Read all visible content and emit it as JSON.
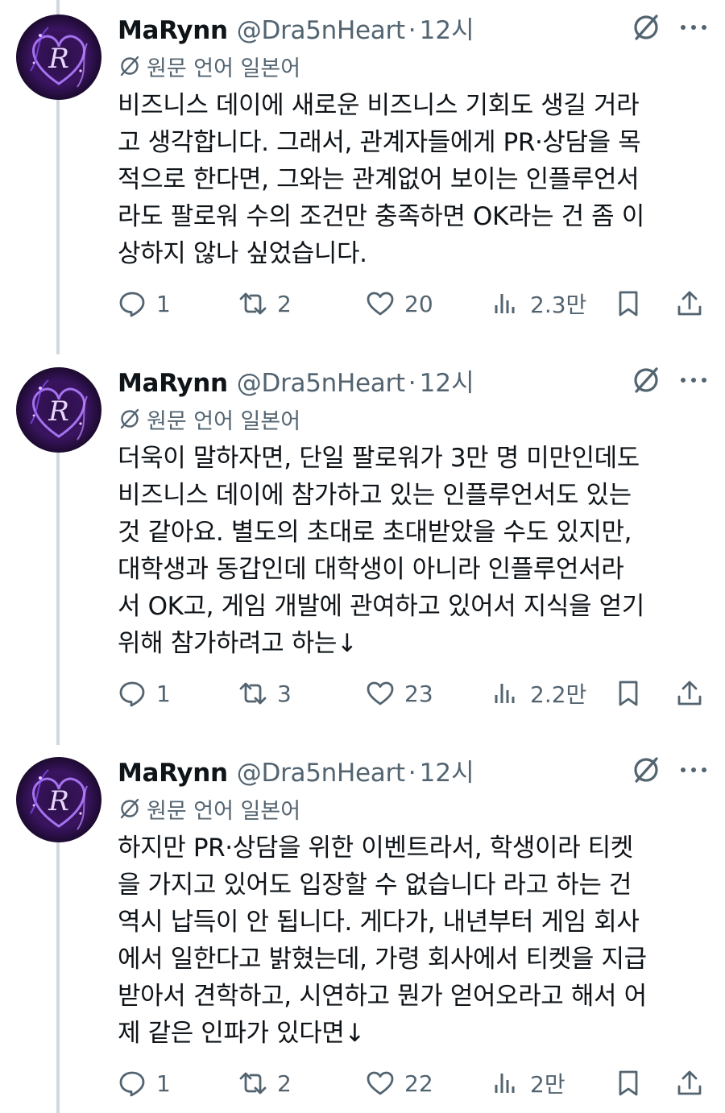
{
  "author": {
    "name": "MaRynn",
    "handle": "@Dra5nHeart",
    "separator": "·",
    "avatar_initial": "R"
  },
  "colors": {
    "text": "#0f1419",
    "secondary": "#536471",
    "thread_line": "#cfd9de",
    "avatar_glow": "#a46bff"
  },
  "tweets": [
    {
      "time": "12시",
      "language_note": "원문 언어 일본어",
      "text": "비즈니스 데이에 새로운 비즈니스 기회도 생길 거라\n고 생각합니다. 그래서, 관계자들에게 PR·상담을 목\n적으로 한다면, 그와는 관계없어 보이는 인플루언서\n라도 팔로워 수의 조건만 충족하면 OK라는 건 좀 이\n상하지 않나 싶었습니다.",
      "replies": "1",
      "retweets": "2",
      "likes": "20",
      "views": "2.3만"
    },
    {
      "time": "12시",
      "language_note": "원문 언어 일본어",
      "text": "더욱이 말하자면, 단일 팔로워가 3만 명 미만인데도\n비즈니스 데이에 참가하고 있는 인플루언서도 있는\n것 같아요. 별도의 초대로 초대받았을 수도 있지만,\n대학생과 동갑인데 대학생이 아니라 인플루언서라\n서 OK고, 게임 개발에 관여하고 있어서 지식을 얻기\n위해 참가하려고 하는↓",
      "replies": "1",
      "retweets": "3",
      "likes": "23",
      "views": "2.2만"
    },
    {
      "time": "12시",
      "language_note": "원문 언어 일본어",
      "text": "하지만 PR·상담을 위한 이벤트라서, 학생이라 티켓\n을 가지고 있어도 입장할 수 없습니다 라고 하는 건\n역시 납득이 안 됩니다. 게다가, 내년부터 게임 회사\n에서 일한다고 밝혔는데, 가령 회사에서 티켓을 지급\n받아서 견학하고, 시연하고 뭔가 얻어오라고 해서 어\n제 같은 인파가 있다면↓",
      "replies": "1",
      "retweets": "2",
      "likes": "22",
      "views": "2만"
    }
  ]
}
